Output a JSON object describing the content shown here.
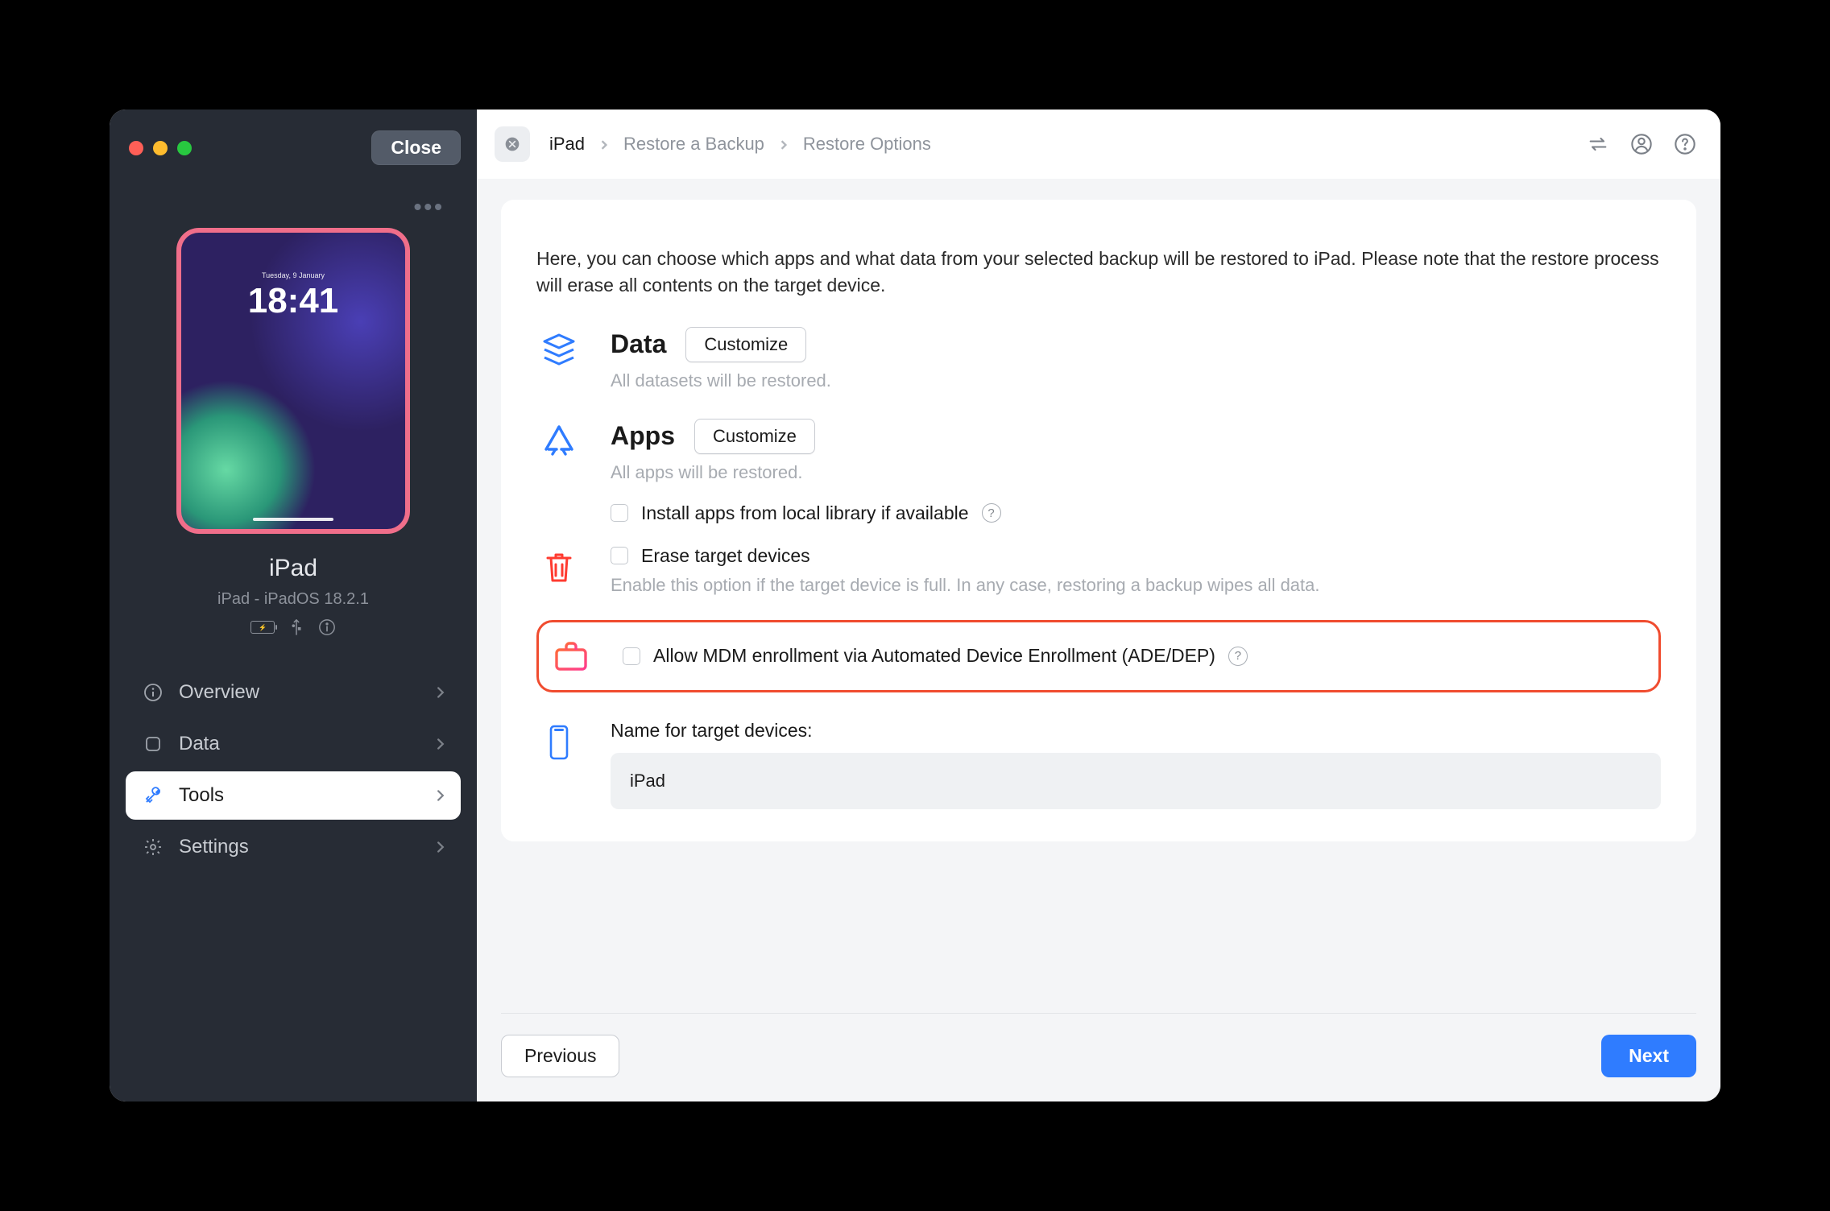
{
  "window": {
    "close_label": "Close"
  },
  "device": {
    "screen_date": "Tuesday, 9 January",
    "screen_time": "18:41",
    "name": "iPad",
    "sub": "iPad - iPadOS 18.2.1"
  },
  "sidebar": {
    "items": [
      {
        "label": "Overview"
      },
      {
        "label": "Data"
      },
      {
        "label": "Tools"
      },
      {
        "label": "Settings"
      }
    ]
  },
  "breadcrumb": {
    "items": [
      "iPad",
      "Restore a Backup",
      "Restore Options"
    ]
  },
  "content": {
    "intro": "Here, you can choose which apps and what data from your selected backup will be restored to iPad. Please note that the restore process will erase all contents on the target device.",
    "data_section": {
      "title": "Data",
      "customize": "Customize",
      "sub": "All datasets will be restored."
    },
    "apps_section": {
      "title": "Apps",
      "customize": "Customize",
      "sub": "All apps will be restored."
    },
    "install_local": "Install apps from local library if available",
    "erase": {
      "label": "Erase target devices",
      "sub": "Enable this option if the target device is full. In any case, restoring a backup wipes all data."
    },
    "mdm": "Allow MDM enrollment via Automated Device Enrollment (ADE/DEP)",
    "name_label": "Name for target devices:",
    "name_value": "iPad"
  },
  "footer": {
    "prev": "Previous",
    "next": "Next"
  },
  "colors": {
    "accent": "#2f7cff",
    "highlight": "#f04c2f"
  }
}
